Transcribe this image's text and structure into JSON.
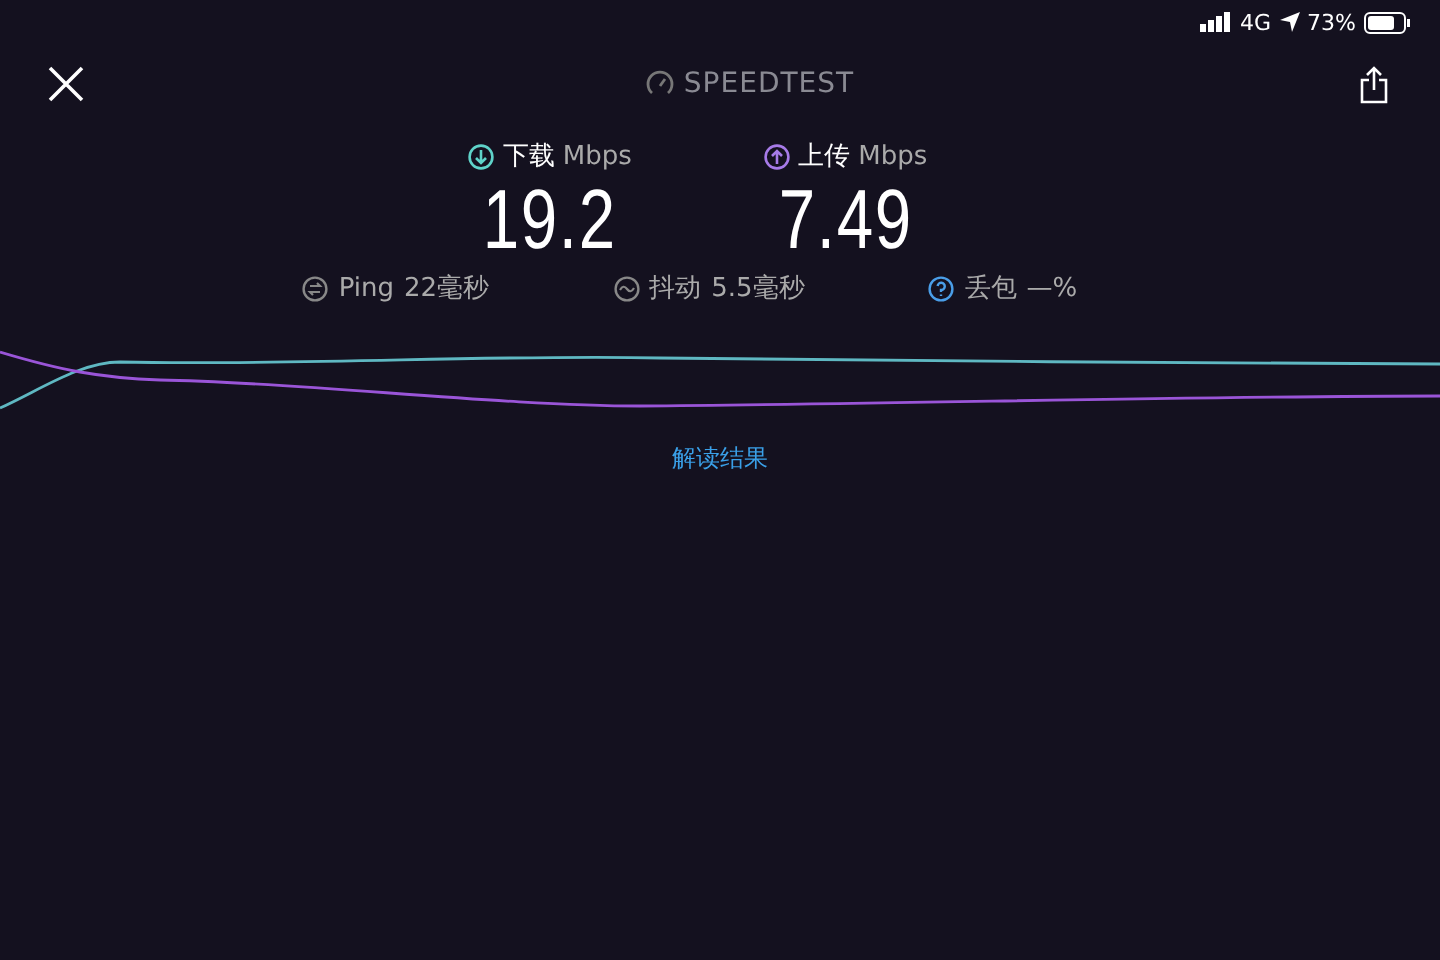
{
  "status_bar": {
    "network": "4G",
    "battery": "73%"
  },
  "header": {
    "title": "SPEEDTEST"
  },
  "results": [
    {
      "kind": "download",
      "label": "下载",
      "unit": "Mbps",
      "value": "19.2"
    },
    {
      "kind": "upload",
      "label": "上传",
      "unit": "Mbps",
      "value": "7.49"
    }
  ],
  "stats": [
    {
      "kind": "ping",
      "label": "Ping",
      "value": "22毫秒"
    },
    {
      "kind": "jitter",
      "label": "抖动",
      "value": "5.5毫秒"
    },
    {
      "kind": "loss",
      "label": "丢包",
      "value": "—%"
    }
  ],
  "link": "解读结果"
}
